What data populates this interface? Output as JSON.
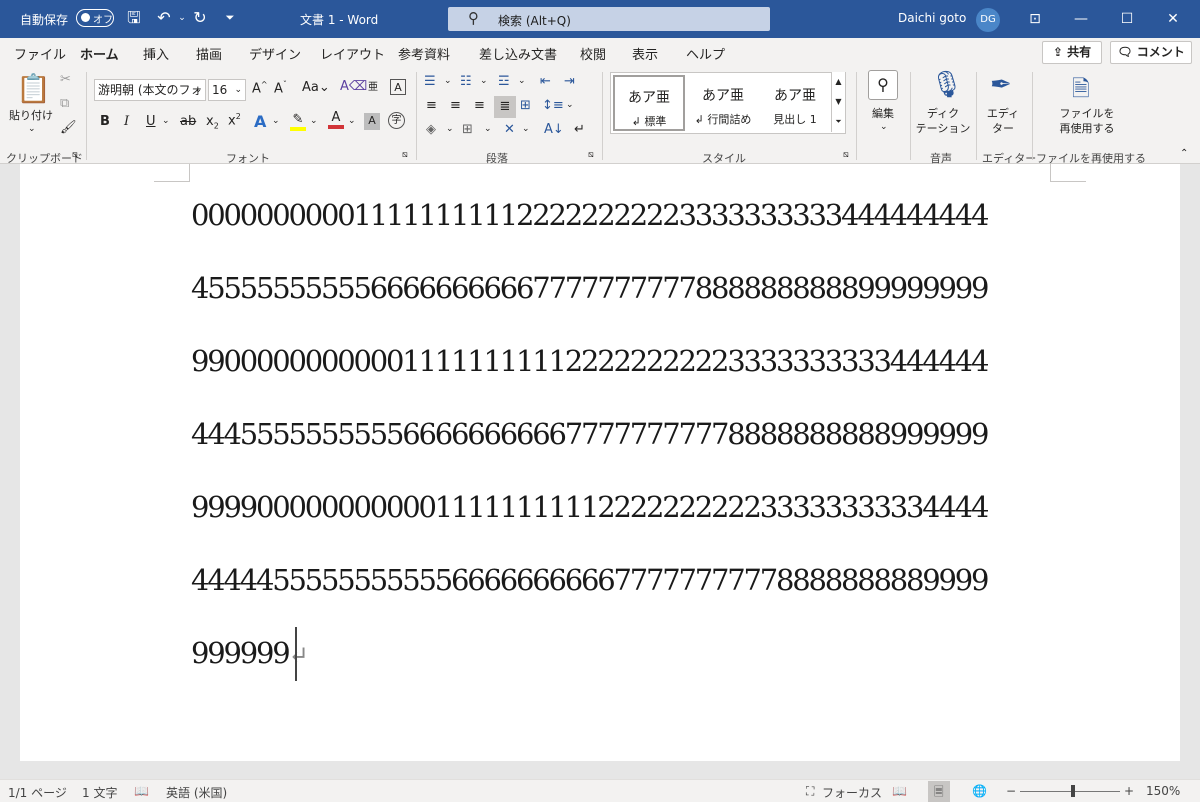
{
  "titlebar": {
    "autosave_label": "自動保存",
    "autosave_state": "オフ",
    "title": "文書 1  -  Word",
    "search_placeholder": "検索 (Alt+Q)",
    "user_name": "Daichi goto",
    "user_initials": "DG"
  },
  "tabs": [
    "ファイル",
    "ホーム",
    "挿入",
    "描画",
    "デザイン",
    "レイアウト",
    "参考資料",
    "差し込み文書",
    "校閲",
    "表示",
    "ヘルプ"
  ],
  "actions": {
    "share": "共有",
    "comment": "コメント"
  },
  "ribbon": {
    "clipboard": {
      "paste": "貼り付け",
      "label": "クリップボード"
    },
    "font": {
      "font_name": "游明朝 (本文のフォ",
      "font_size": "16",
      "label": "フォント"
    },
    "paragraph": {
      "label": "段落"
    },
    "styles": {
      "label": "スタイル",
      "items": [
        {
          "sample": "あア亜",
          "name": "↲ 標準"
        },
        {
          "sample": "あア亜",
          "name": "↲ 行間詰め"
        },
        {
          "sample": "あア亜",
          "name": "見出し 1"
        }
      ]
    },
    "editing": {
      "label": "編集"
    },
    "voice": {
      "button": "ディク\nテーション",
      "label": "音声"
    },
    "editor": {
      "button": "エディ\nター",
      "label": "エディター"
    },
    "reuse": {
      "button": "ファイルを\n再使用する",
      "label": "ファイルを再使用する"
    }
  },
  "document": {
    "lines": [
      "0000000000111111111122222222223333333333444444444",
      "4555555555566666666667777777777888888888899999999",
      "9900000000000111111111122222222223333333333444444",
      "4445555555555666666666677777777778888888888999999",
      "9999000000000001111111111222222222233333333334444",
      "4444455555555555666666666677777777778888888889999",
      "999999"
    ],
    "paragraph_mark": "↵"
  },
  "statusbar": {
    "page": "1/1 ページ",
    "words": "1 文字",
    "language": "英語 (米国)",
    "focus": "フォーカス",
    "zoom_percent": "150%",
    "zoom_level": 150
  }
}
